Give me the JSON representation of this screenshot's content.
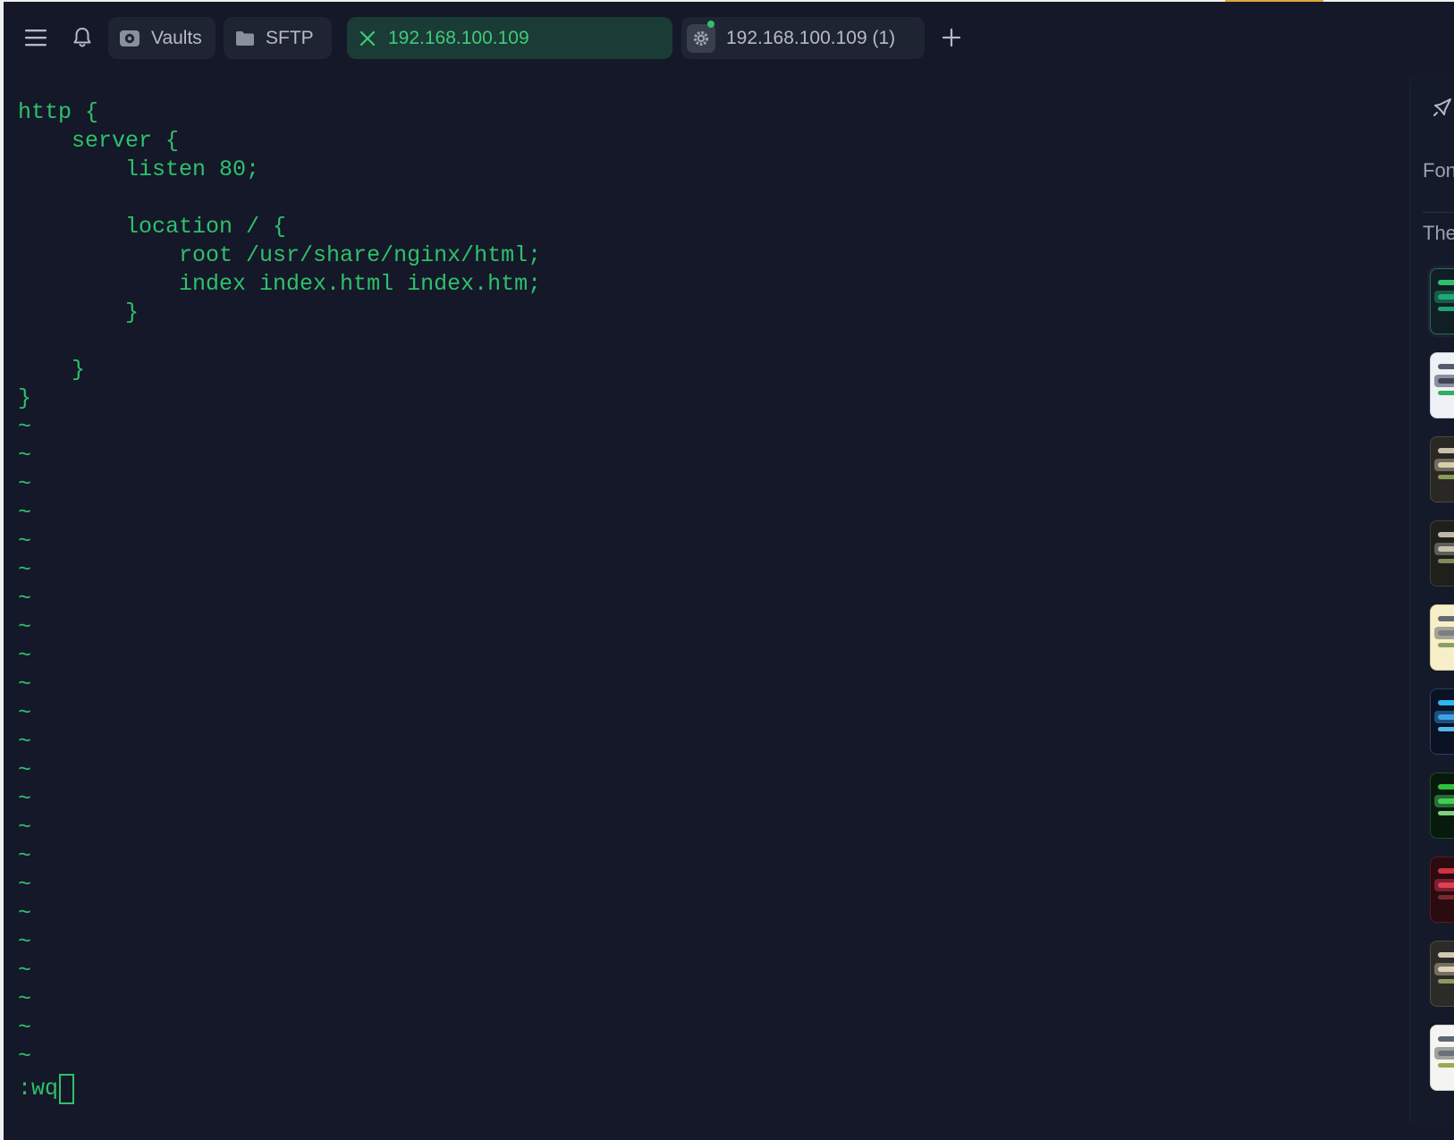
{
  "topbar": {
    "tabs": [
      {
        "label": "Vaults",
        "icon": "vault-icon",
        "active": false
      },
      {
        "label": "SFTP",
        "icon": "folder-icon",
        "active": false
      },
      {
        "label": "192.168.100.109",
        "icon": "close-icon",
        "active": true
      },
      {
        "label": "192.168.100.109 (1)",
        "icon": "gear-icon",
        "active": false
      }
    ]
  },
  "terminal": {
    "lines": [
      "http {",
      "    server {",
      "        listen 80;",
      "",
      "        location / {",
      "            root /usr/share/nginx/html;",
      "            index index.html index.htm;",
      "        }",
      "",
      "    }",
      "}"
    ],
    "tilde": "~",
    "command": ":wq"
  },
  "side_panel": {
    "font_label": "Fon",
    "theme_label": "The",
    "themes": [
      {
        "name": "theme-green",
        "bg": "#0f1f25",
        "border": "#2f6a52",
        "bar1": "#2fc06a",
        "bar2": "#1fa87a",
        "bar3": "#22a070",
        "hl": "#1b5a48"
      },
      {
        "name": "theme-light",
        "bg": "#eef1f5",
        "border": "#c9ced8",
        "bar1": "#555b6b",
        "bar2": "#3f4656",
        "bar3": "#2fb060",
        "hl": "#8a90a0"
      },
      {
        "name": "theme-tan",
        "bg": "#2a2824",
        "border": "#4a463f",
        "bar1": "#c9c1a8",
        "bar2": "#d7cfaa",
        "bar3": "#8a9a5a",
        "hl": "#706b5f"
      },
      {
        "name": "theme-dark-olive",
        "bg": "#1f1f1c",
        "border": "#3f3f39",
        "bar1": "#bdb8a8",
        "bar2": "#c6c1ae",
        "bar3": "#7f8a5a",
        "hl": "#5f5d55"
      },
      {
        "name": "theme-cream",
        "bg": "#f6efc9",
        "border": "#d8cfa0",
        "bar1": "#666a70",
        "bar2": "#7a7f86",
        "bar3": "#8aa060",
        "hl": "#a6a390"
      },
      {
        "name": "theme-ocean",
        "bg": "#0b1224",
        "border": "#2b3e63",
        "bar1": "#2fb6f0",
        "bar2": "#3fa2e6",
        "bar3": "#4fb8f0",
        "hl": "#1d4f80"
      },
      {
        "name": "theme-matrix",
        "bg": "#071a0c",
        "border": "#1f4a2a",
        "bar1": "#2fc040",
        "bar2": "#3fd050",
        "bar3": "#7fd080",
        "hl": "#2a6a3a"
      },
      {
        "name": "theme-crimson",
        "bg": "#2a0b10",
        "border": "#5a1a22",
        "bar1": "#d03040",
        "bar2": "#e04050",
        "bar3": "#7a2a30",
        "hl": "#7a2030"
      },
      {
        "name": "theme-sand",
        "bg": "#2c2b28",
        "border": "#4c4a44",
        "bar1": "#d2c8b0",
        "bar2": "#ddd2b5",
        "bar3": "#8a9a5e",
        "hl": "#746f62"
      },
      {
        "name": "theme-paper",
        "bg": "#f4f5f2",
        "border": "#cfd2cc",
        "bar1": "#5f6670",
        "bar2": "#6a717a",
        "bar3": "#9aaa50",
        "hl": "#9ea39c"
      }
    ]
  }
}
